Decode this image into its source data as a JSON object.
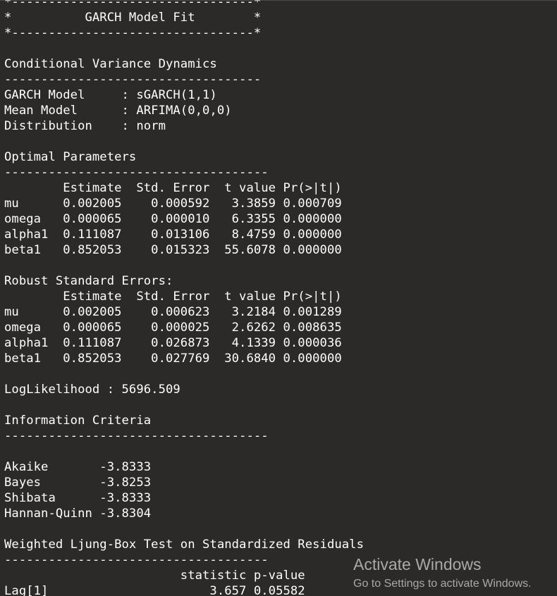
{
  "console": {
    "lines": [
      "*---------------------------------*",
      "*          GARCH Model Fit        *",
      "*---------------------------------*",
      "",
      "Conditional Variance Dynamics",
      "-----------------------------------",
      "GARCH Model     : sGARCH(1,1)",
      "Mean Model      : ARFIMA(0,0,0)",
      "Distribution    : norm",
      "",
      "Optimal Parameters",
      "------------------------------------",
      "        Estimate  Std. Error  t value Pr(>|t|)",
      "mu      0.002005    0.000592   3.3859 0.000709",
      "omega   0.000065    0.000010   6.3355 0.000000",
      "alpha1  0.111087    0.013106   8.4759 0.000000",
      "beta1   0.852053    0.015323  55.6078 0.000000",
      "",
      "Robust Standard Errors:",
      "        Estimate  Std. Error  t value Pr(>|t|)",
      "mu      0.002005    0.000623   3.2184 0.001289",
      "omega   0.000065    0.000025   2.6262 0.008635",
      "alpha1  0.111087    0.026873   4.1339 0.000036",
      "beta1   0.852053    0.027769  30.6840 0.000000",
      "",
      "LogLikelihood : 5696.509",
      "",
      "Information Criteria",
      "------------------------------------",
      "",
      "Akaike       -3.8333",
      "Bayes        -3.8253",
      "Shibata      -3.8333",
      "Hannan-Quinn -3.8304",
      "",
      "Weighted Ljung-Box Test on Standardized Residuals",
      "------------------------------------",
      "                        statistic p-value",
      "Lag[1]                      3.657 0.05582"
    ]
  },
  "watermark": {
    "title": "Activate Windows",
    "subtitle": "Go to Settings to activate Windows."
  },
  "colors": {
    "background": "#2b2a28",
    "text": "#ffffff",
    "watermark": "#a9a9a7"
  }
}
